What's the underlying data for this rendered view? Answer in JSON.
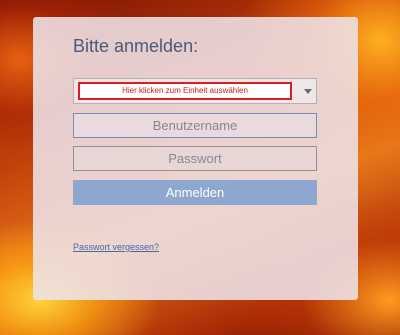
{
  "login": {
    "title": "Bitte anmelden:",
    "unit_select_text": "Hier klicken zum Einheit auswählen",
    "username_placeholder": "Benutzername",
    "password_placeholder": "Passwort",
    "submit_label": "Anmelden",
    "forgot_link": "Passwort vergessen?"
  },
  "colors": {
    "accent_button": "#8ea7cf",
    "highlight_border": "#e01c1c",
    "link": "#4a64a8"
  }
}
